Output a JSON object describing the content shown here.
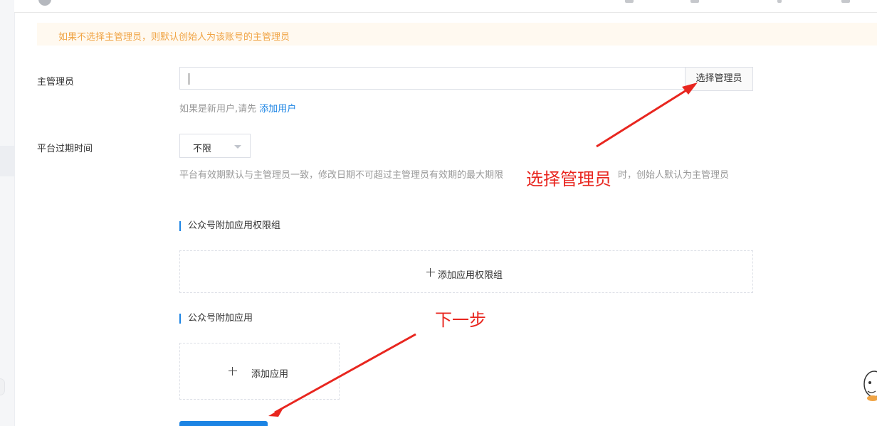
{
  "notice": {
    "text": "如果不选择主管理员，则默认创始人为该账号的主管理员"
  },
  "admin": {
    "label": "主管理员",
    "input_value": "",
    "select_button": "选择管理员",
    "hint_prefix": "如果是新用户,请先",
    "hint_link": "添加用户"
  },
  "expiry": {
    "label": "平台过期时间",
    "selected": "不限",
    "hint": "平台有效期默认与主管理员一致，修改日期不可超过主管理员有效期的最大期限",
    "hint_tail": "时，创始人默认为主管理员"
  },
  "permission_group": {
    "title": "公众号附加应用权限组",
    "add_label": "添加应用权限组"
  },
  "extra_apps": {
    "title": "公众号附加应用",
    "add_label": "添加应用"
  },
  "annotations": {
    "select_admin": "选择管理员",
    "next_step": "下一步"
  },
  "colors": {
    "accent": "#1c84e4",
    "warning_text": "#f0a445",
    "warning_bg": "#fff9f0",
    "annotation": "#e8261f"
  },
  "icons": {
    "plus": "plus-icon",
    "dropdown": "chevron-down-icon"
  }
}
